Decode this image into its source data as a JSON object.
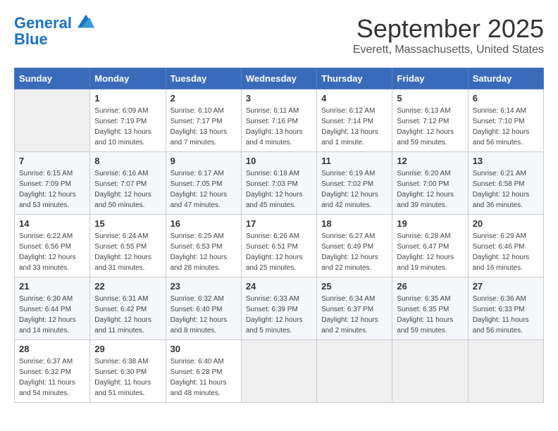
{
  "header": {
    "logo_line1": "General",
    "logo_line2": "Blue",
    "month": "September 2025",
    "location": "Everett, Massachusetts, United States"
  },
  "weekdays": [
    "Sunday",
    "Monday",
    "Tuesday",
    "Wednesday",
    "Thursday",
    "Friday",
    "Saturday"
  ],
  "weeks": [
    [
      {
        "day": "",
        "sunrise": "",
        "sunset": "",
        "daylight": ""
      },
      {
        "day": "1",
        "sunrise": "Sunrise: 6:09 AM",
        "sunset": "Sunset: 7:19 PM",
        "daylight": "Daylight: 13 hours and 10 minutes."
      },
      {
        "day": "2",
        "sunrise": "Sunrise: 6:10 AM",
        "sunset": "Sunset: 7:17 PM",
        "daylight": "Daylight: 13 hours and 7 minutes."
      },
      {
        "day": "3",
        "sunrise": "Sunrise: 6:11 AM",
        "sunset": "Sunset: 7:16 PM",
        "daylight": "Daylight: 13 hours and 4 minutes."
      },
      {
        "day": "4",
        "sunrise": "Sunrise: 6:12 AM",
        "sunset": "Sunset: 7:14 PM",
        "daylight": "Daylight: 13 hours and 1 minute."
      },
      {
        "day": "5",
        "sunrise": "Sunrise: 6:13 AM",
        "sunset": "Sunset: 7:12 PM",
        "daylight": "Daylight: 12 hours and 59 minutes."
      },
      {
        "day": "6",
        "sunrise": "Sunrise: 6:14 AM",
        "sunset": "Sunset: 7:10 PM",
        "daylight": "Daylight: 12 hours and 56 minutes."
      }
    ],
    [
      {
        "day": "7",
        "sunrise": "Sunrise: 6:15 AM",
        "sunset": "Sunset: 7:09 PM",
        "daylight": "Daylight: 12 hours and 53 minutes."
      },
      {
        "day": "8",
        "sunrise": "Sunrise: 6:16 AM",
        "sunset": "Sunset: 7:07 PM",
        "daylight": "Daylight: 12 hours and 50 minutes."
      },
      {
        "day": "9",
        "sunrise": "Sunrise: 6:17 AM",
        "sunset": "Sunset: 7:05 PM",
        "daylight": "Daylight: 12 hours and 47 minutes."
      },
      {
        "day": "10",
        "sunrise": "Sunrise: 6:18 AM",
        "sunset": "Sunset: 7:03 PM",
        "daylight": "Daylight: 12 hours and 45 minutes."
      },
      {
        "day": "11",
        "sunrise": "Sunrise: 6:19 AM",
        "sunset": "Sunset: 7:02 PM",
        "daylight": "Daylight: 12 hours and 42 minutes."
      },
      {
        "day": "12",
        "sunrise": "Sunrise: 6:20 AM",
        "sunset": "Sunset: 7:00 PM",
        "daylight": "Daylight: 12 hours and 39 minutes."
      },
      {
        "day": "13",
        "sunrise": "Sunrise: 6:21 AM",
        "sunset": "Sunset: 6:58 PM",
        "daylight": "Daylight: 12 hours and 36 minutes."
      }
    ],
    [
      {
        "day": "14",
        "sunrise": "Sunrise: 6:22 AM",
        "sunset": "Sunset: 6:56 PM",
        "daylight": "Daylight: 12 hours and 33 minutes."
      },
      {
        "day": "15",
        "sunrise": "Sunrise: 6:24 AM",
        "sunset": "Sunset: 6:55 PM",
        "daylight": "Daylight: 12 hours and 31 minutes."
      },
      {
        "day": "16",
        "sunrise": "Sunrise: 6:25 AM",
        "sunset": "Sunset: 6:53 PM",
        "daylight": "Daylight: 12 hours and 28 minutes."
      },
      {
        "day": "17",
        "sunrise": "Sunrise: 6:26 AM",
        "sunset": "Sunset: 6:51 PM",
        "daylight": "Daylight: 12 hours and 25 minutes."
      },
      {
        "day": "18",
        "sunrise": "Sunrise: 6:27 AM",
        "sunset": "Sunset: 6:49 PM",
        "daylight": "Daylight: 12 hours and 22 minutes."
      },
      {
        "day": "19",
        "sunrise": "Sunrise: 6:28 AM",
        "sunset": "Sunset: 6:47 PM",
        "daylight": "Daylight: 12 hours and 19 minutes."
      },
      {
        "day": "20",
        "sunrise": "Sunrise: 6:29 AM",
        "sunset": "Sunset: 6:46 PM",
        "daylight": "Daylight: 12 hours and 16 minutes."
      }
    ],
    [
      {
        "day": "21",
        "sunrise": "Sunrise: 6:30 AM",
        "sunset": "Sunset: 6:44 PM",
        "daylight": "Daylight: 12 hours and 14 minutes."
      },
      {
        "day": "22",
        "sunrise": "Sunrise: 6:31 AM",
        "sunset": "Sunset: 6:42 PM",
        "daylight": "Daylight: 12 hours and 11 minutes."
      },
      {
        "day": "23",
        "sunrise": "Sunrise: 6:32 AM",
        "sunset": "Sunset: 6:40 PM",
        "daylight": "Daylight: 12 hours and 8 minutes."
      },
      {
        "day": "24",
        "sunrise": "Sunrise: 6:33 AM",
        "sunset": "Sunset: 6:39 PM",
        "daylight": "Daylight: 12 hours and 5 minutes."
      },
      {
        "day": "25",
        "sunrise": "Sunrise: 6:34 AM",
        "sunset": "Sunset: 6:37 PM",
        "daylight": "Daylight: 12 hours and 2 minutes."
      },
      {
        "day": "26",
        "sunrise": "Sunrise: 6:35 AM",
        "sunset": "Sunset: 6:35 PM",
        "daylight": "Daylight: 11 hours and 59 minutes."
      },
      {
        "day": "27",
        "sunrise": "Sunrise: 6:36 AM",
        "sunset": "Sunset: 6:33 PM",
        "daylight": "Daylight: 11 hours and 56 minutes."
      }
    ],
    [
      {
        "day": "28",
        "sunrise": "Sunrise: 6:37 AM",
        "sunset": "Sunset: 6:32 PM",
        "daylight": "Daylight: 11 hours and 54 minutes."
      },
      {
        "day": "29",
        "sunrise": "Sunrise: 6:38 AM",
        "sunset": "Sunset: 6:30 PM",
        "daylight": "Daylight: 11 hours and 51 minutes."
      },
      {
        "day": "30",
        "sunrise": "Sunrise: 6:40 AM",
        "sunset": "Sunset: 6:28 PM",
        "daylight": "Daylight: 11 hours and 48 minutes."
      },
      {
        "day": "",
        "sunrise": "",
        "sunset": "",
        "daylight": ""
      },
      {
        "day": "",
        "sunrise": "",
        "sunset": "",
        "daylight": ""
      },
      {
        "day": "",
        "sunrise": "",
        "sunset": "",
        "daylight": ""
      },
      {
        "day": "",
        "sunrise": "",
        "sunset": "",
        "daylight": ""
      }
    ]
  ]
}
